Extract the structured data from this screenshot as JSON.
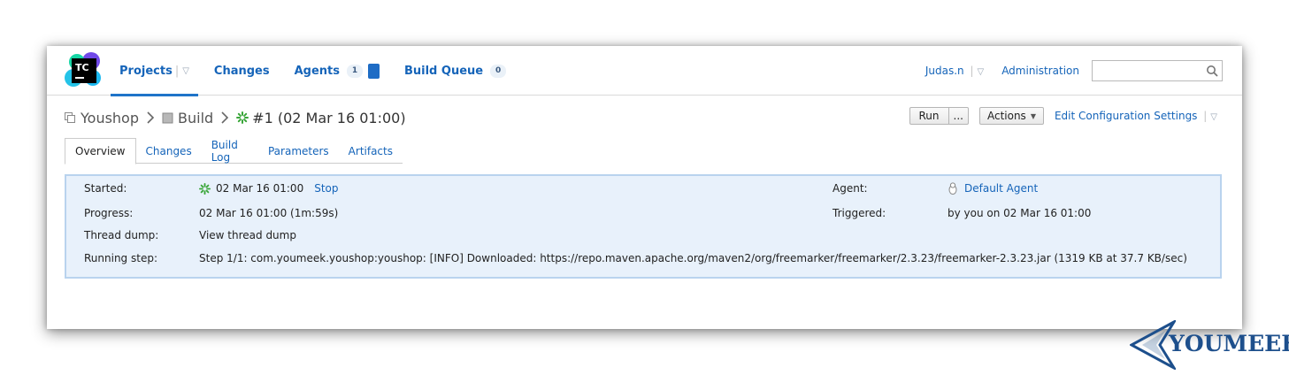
{
  "nav": {
    "items": [
      {
        "label": "Projects",
        "active": true
      },
      {
        "label": "Changes"
      },
      {
        "label": "Agents",
        "count": "1"
      },
      {
        "label": "Build Queue",
        "count": "0"
      }
    ]
  },
  "user": {
    "name": "Judas.n"
  },
  "admin_label": "Administration",
  "search": {
    "placeholder": ""
  },
  "breadcrumb": {
    "project": "Youshop",
    "build_config": "Build",
    "build": "#1 (02 Mar 16 01:00)"
  },
  "actions": {
    "run_label": "Run",
    "more_label": "...",
    "actions_label": "Actions",
    "edit_label": "Edit Configuration Settings"
  },
  "tabs": [
    "Overview",
    "Changes",
    "Build Log",
    "Parameters",
    "Artifacts"
  ],
  "details": {
    "started_label": "Started:",
    "started_value": "02 Mar 16 01:00",
    "stop_label": "Stop",
    "progress_label": "Progress:",
    "progress_value": "02 Mar 16 01:00 (1m:59s)",
    "thread_dump_label": "Thread dump:",
    "thread_dump_value": "View thread dump",
    "running_step_label": "Running step:",
    "running_step_value": "Step 1/1: com.youmeek.youshop:youshop: [INFO] Downloaded: https://repo.maven.apache.org/maven2/org/freemarker/freemarker/2.3.23/freemarker-2.3.23.jar (1319 KB at 37.7 KB/sec)",
    "agent_label": "Agent:",
    "agent_value": "Default Agent",
    "triggered_label": "Triggered:",
    "triggered_value": "by you on 02 Mar 16 01:00"
  },
  "logo_text": "TC",
  "watermark": {
    "text": "YOUMEEK"
  },
  "colors": {
    "link": "#1564b9",
    "panel_bg": "#e8f1fb",
    "panel_border": "#b9d3ee",
    "accent": "#1f74c9"
  }
}
